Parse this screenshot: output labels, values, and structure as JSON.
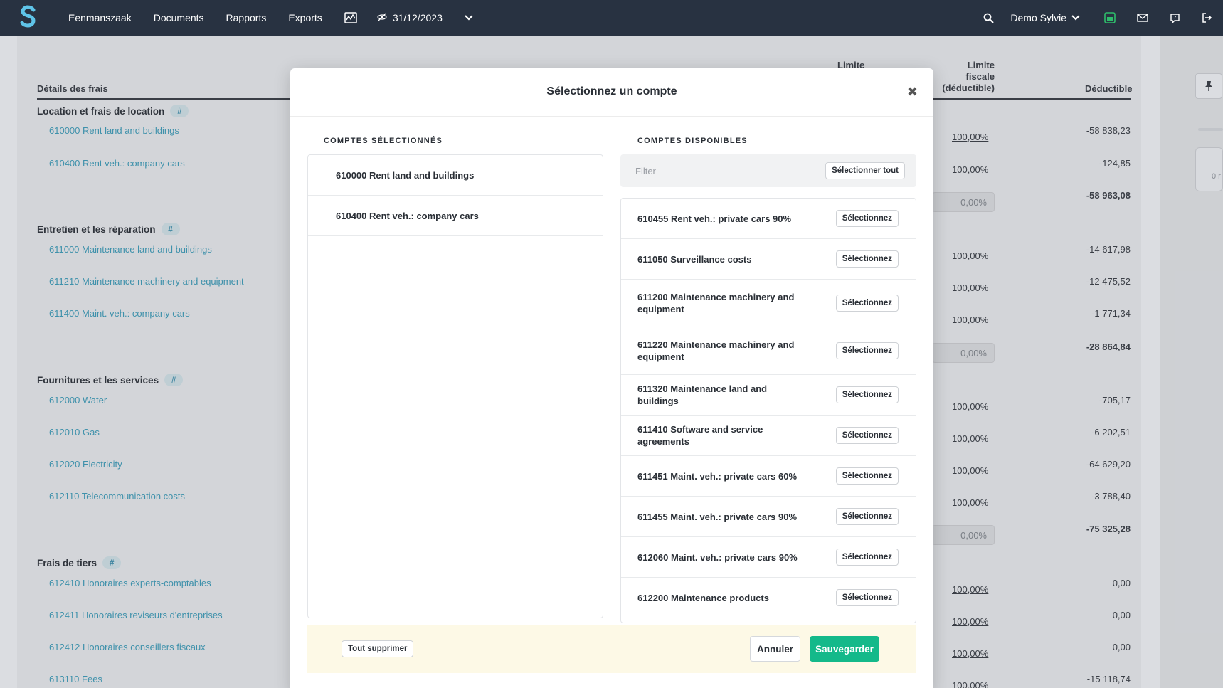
{
  "nav": {
    "items": [
      "Eenmanszaak",
      "Documents",
      "Rapports",
      "Exports"
    ],
    "date": "31/12/2023",
    "user": "Demo Sylvie",
    "icons": [
      "chart-icon",
      "eye-icon",
      "chevron-down-icon",
      "search-icon",
      "app-badge-icon",
      "mail-icon",
      "help-icon",
      "logout-icon"
    ],
    "colors": {
      "bar": "#283241",
      "logo": "#5fc4e8",
      "badge": "#2ebd6b"
    }
  },
  "background": {
    "headers": {
      "details": "Détails des frais",
      "limite": "Limite",
      "limite_fiscale": [
        "Limite",
        "fiscale",
        "(déductible)"
      ],
      "deductible": "Déductible"
    },
    "rail_text": "0 r",
    "categories": [
      {
        "label": "Location et frais de location"
      },
      {
        "label": "Entretien et les réparation"
      },
      {
        "label": "Fournitures et les services"
      },
      {
        "label": "Frais de tiers"
      }
    ],
    "hash_symbol": "#",
    "accounts": [
      {
        "label": "610000 Rent land and buildings",
        "pct": "100,00%",
        "amount": "-58 838,23"
      },
      {
        "label": "610400 Rent veh.: company cars",
        "pct": "100,00%",
        "amount": "-124,85"
      },
      {
        "label": "611000 Maintenance land and buildings",
        "pct": "100,00%",
        "amount": "-14 617,98"
      },
      {
        "label": "611210 Maintenance machinery and equipment",
        "pct": "100,00%",
        "amount": "-12 475,52"
      },
      {
        "label": "611400 Maint. veh.: company cars",
        "pct": "100,00%",
        "amount": "-1 771,34"
      },
      {
        "label": "612000 Water",
        "pct": "100,00%",
        "amount": "-705,17"
      },
      {
        "label": "612010 Gas",
        "pct": "100,00%",
        "amount": "-6 202,51"
      },
      {
        "label": "612020 Electricity",
        "pct": "100,00%",
        "amount": "-64 629,20"
      },
      {
        "label": "612110 Telecommunication costs",
        "pct": "100,00%",
        "amount": "-3 788,40"
      },
      {
        "label": "612410 Honoraires experts-comptables",
        "pct": "100,00%",
        "amount": "0,00"
      },
      {
        "label": "612411 Honoraires reviseurs d'entreprises",
        "pct": "100,00%",
        "amount": "0,00"
      },
      {
        "label": "612412 Honoraires conseillers fiscaux",
        "pct": "100,00%",
        "amount": "0,00"
      },
      {
        "label": "613110 Fees",
        "pct": "100,00%",
        "amount": "-15 118,74"
      }
    ],
    "subtotals": [
      {
        "pct": "0,00%",
        "amount": "-58 963,08"
      },
      {
        "pct": "0,00%",
        "amount": "-28 864,84"
      },
      {
        "pct": "0,00%",
        "amount": "-75 325,28"
      }
    ]
  },
  "modal": {
    "title": "Sélectionnez un compte",
    "close": "✖",
    "selected_title": "COMPTES SÉLECTIONNÉS",
    "available_title": "COMPTES DISPONIBLES",
    "filter_placeholder": "Filter",
    "select_all": "Sélectionner tout",
    "select_label": "Sélectionnez",
    "selected": [
      "610000 Rent land and buildings",
      "610400 Rent veh.: company cars"
    ],
    "available": [
      "610455 Rent veh.: private cars 90%",
      "611050 Surveillance costs",
      "611200 Maintenance machinery and equipment",
      "611220 Maintenance machinery and equipment",
      "611320 Maintenance land and buildings",
      "611410 Software and service agreements",
      "611451 Maint. veh.: private cars 60%",
      "611455 Maint. veh.: private cars 90%",
      "612060 Maint. veh.: private cars 90%",
      "612200 Maintenance products"
    ],
    "clear_all": "Tout supprimer",
    "cancel": "Annuler",
    "save": "Sauvegarder"
  }
}
